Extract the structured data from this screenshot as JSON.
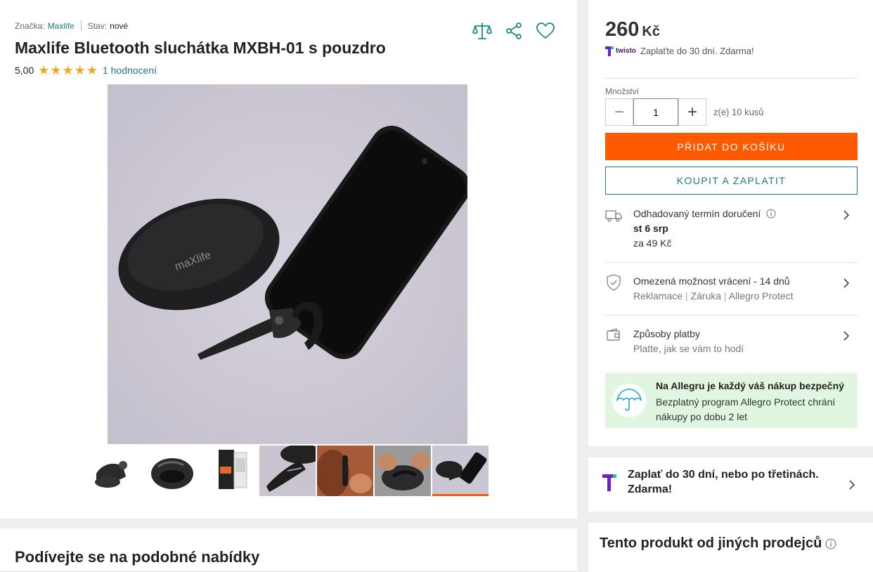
{
  "product": {
    "brand_label": "Značka:",
    "brand": "Maxlife",
    "condition_label": "Stav:",
    "condition": "nové",
    "title": "Maxlife Bluetooth sluchátka MXBH-01 s pouzdro",
    "rating_value": "5,00",
    "rating_stars": 5,
    "reviews_link": "1 hodnocení",
    "action_icons": [
      "compare-scales-icon",
      "share-icon",
      "heart-icon"
    ],
    "image_logo": "maXlife",
    "thumbnails": [
      "thumb-headset",
      "thumb-headset-case",
      "thumb-box",
      "thumb-headset-closeup",
      "thumb-worn",
      "thumb-hands-case",
      "thumb-case-phone"
    ],
    "active_thumbnail": 7
  },
  "similar": {
    "heading": "Podívejte se na podobné nabídky"
  },
  "buy_box": {
    "price": "260",
    "currency": "Kč",
    "twisto_brand": "twisto",
    "twisto_text": "Zaplaťte do 30 dní. Zdarma!",
    "quantity_label": "Množství",
    "quantity_value": "1",
    "quantity_minus": "−",
    "quantity_plus": "+",
    "availability": "z(e) 10 kusů",
    "add_to_cart": "PŘIDAT DO KOŠÍKU",
    "buy_now": "KOUPIT A ZAPLATIT",
    "delivery": {
      "title": "Odhadovaný termín doručení",
      "date": "st 6 srp",
      "price": "za 49 Kč"
    },
    "returns": {
      "title": "Omezená možnost vrácení - 14 dnů",
      "links": [
        "Reklamace",
        "Záruka",
        "Allegro Protect"
      ]
    },
    "payment": {
      "title": "Způsoby platby",
      "subtitle": "Platte, jak se vám to hodí"
    },
    "protect": {
      "title": "Na Allegru je každý váš nákup bezpečný",
      "text": "Bezplatný program Allegro Protect chrání nákupy po dobu 2 let"
    }
  },
  "twisto_banner": {
    "text": "Zaplať do 30 dní, nebo po třetinách. Zdarma!"
  },
  "other_sellers": {
    "heading": "Tento produkt od jiných prodejců"
  },
  "colors": {
    "accent": "#ff5a00",
    "teal": "#1a7a76",
    "star": "#f5a623",
    "protect_bg": "#e1f6e1"
  }
}
